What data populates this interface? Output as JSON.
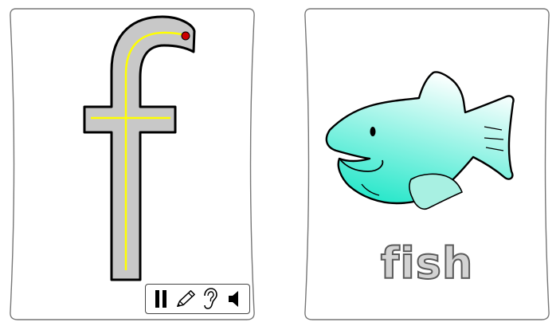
{
  "letter_card": {
    "letter": "f",
    "letter_fill": "#c8c8c8",
    "guide_color": "#ffff00",
    "start_dot_color": "#cc0000"
  },
  "toolbar": {
    "tools": [
      {
        "name": "pause-icon"
      },
      {
        "name": "pencil-icon"
      },
      {
        "name": "ear-icon"
      },
      {
        "name": "speaker-icon"
      }
    ]
  },
  "word_card": {
    "word": "fish",
    "fish_colors": [
      "#ffffff",
      "#1fe6c8"
    ]
  }
}
